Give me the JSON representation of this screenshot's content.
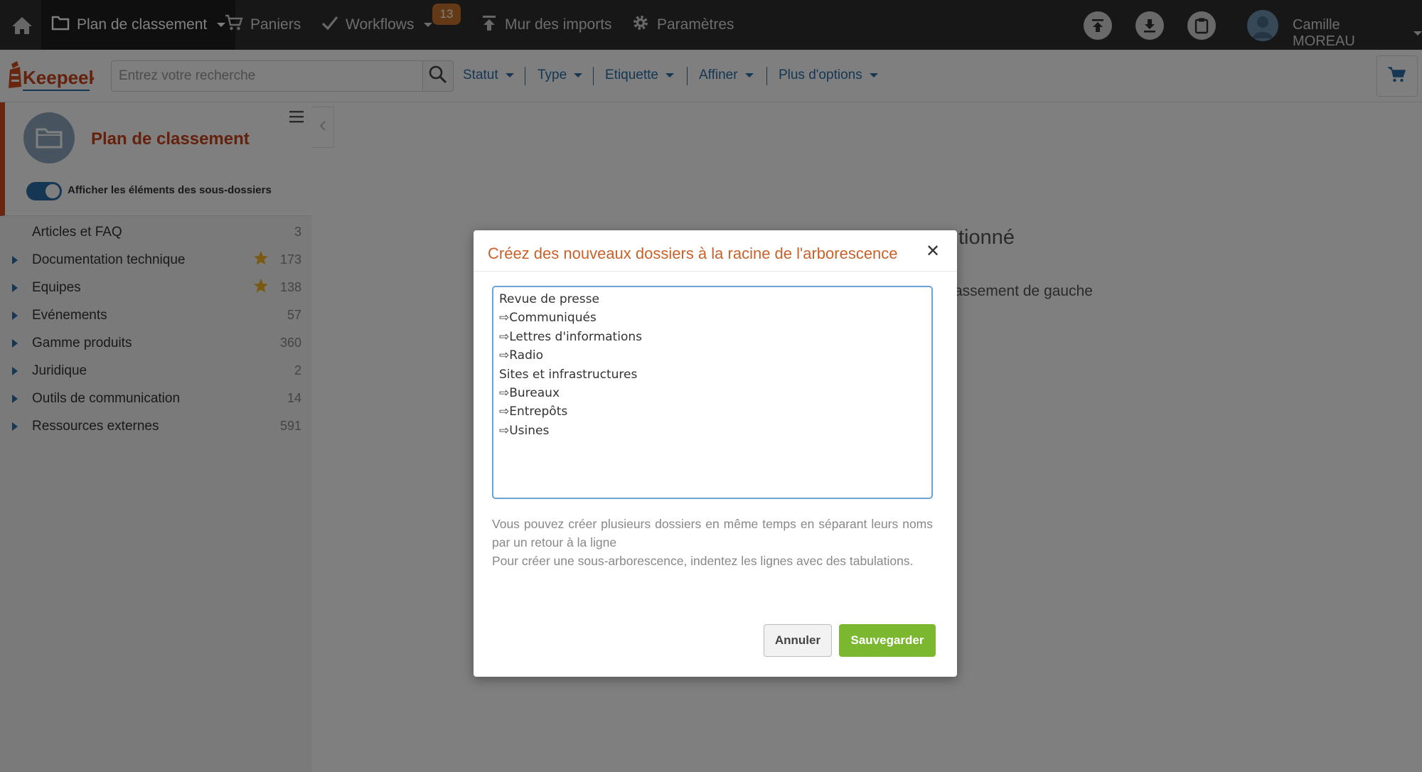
{
  "topnav": {
    "home_icon": "home-icon",
    "items": [
      {
        "label": "Plan de classement",
        "icon": "folder-icon"
      },
      {
        "label": "Paniers",
        "icon": "cart-icon"
      },
      {
        "label": "Workflows",
        "icon": "check-icon"
      },
      {
        "label": "Mur des imports",
        "icon": "upload-icon"
      },
      {
        "label": "Paramètres",
        "icon": "gear-icon"
      }
    ],
    "workflows_badge": "13",
    "badge_color": "#c8742c",
    "right_icons": [
      "upload-circle-icon",
      "download-circle-icon",
      "clipboard-circle-icon"
    ],
    "user_name": "Camille MOREAU"
  },
  "searchbar": {
    "logo_text": "Keepeek",
    "placeholder": "Entrez votre recherche",
    "filters": [
      "Statut",
      "Type",
      "Etiquette",
      "Affiner",
      "Plus d'options"
    ],
    "accent": "#2a6fa8"
  },
  "sidebar": {
    "title": "Plan de classement",
    "toggle_label": "Afficher les éléments des sous-dossiers",
    "toggle_on": true,
    "items": [
      {
        "label": "Articles et FAQ",
        "count": "3",
        "expandable": false,
        "starred": false
      },
      {
        "label": "Documentation technique",
        "count": "173",
        "expandable": true,
        "starred": true
      },
      {
        "label": "Equipes",
        "count": "138",
        "expandable": true,
        "starred": true
      },
      {
        "label": "Evénements",
        "count": "57",
        "expandable": true,
        "starred": false
      },
      {
        "label": "Gamme produits",
        "count": "360",
        "expandable": true,
        "starred": false
      },
      {
        "label": "Juridique",
        "count": "2",
        "expandable": true,
        "starred": false
      },
      {
        "label": "Outils de communication",
        "count": "14",
        "expandable": true,
        "starred": false
      },
      {
        "label": "Ressources externes",
        "count": "591",
        "expandable": true,
        "starred": false
      }
    ]
  },
  "background": {
    "message_partial": "tionné",
    "hint_partial": "assement de gauche"
  },
  "modal": {
    "title": "Créez des nouveaux dossiers à la racine de l'arborescence",
    "textarea_value": "Revue de presse\n⇨Communiqués\n⇨Lettres d'informations\n⇨Radio\nSites et infrastructures\n⇨Bureaux\n⇨Entrepôts\n⇨Usines",
    "help_line1": "Vous pouvez créer plusieurs dossiers en même temps en séparant leurs noms par un retour à la ligne",
    "help_line2": "Pour créer une sous-arborescence, indentez les lignes avec des tabulations.",
    "cancel_label": "Annuler",
    "save_label": "Sauvegarder",
    "save_color": "#7cb82f",
    "title_color": "#c8622a"
  }
}
